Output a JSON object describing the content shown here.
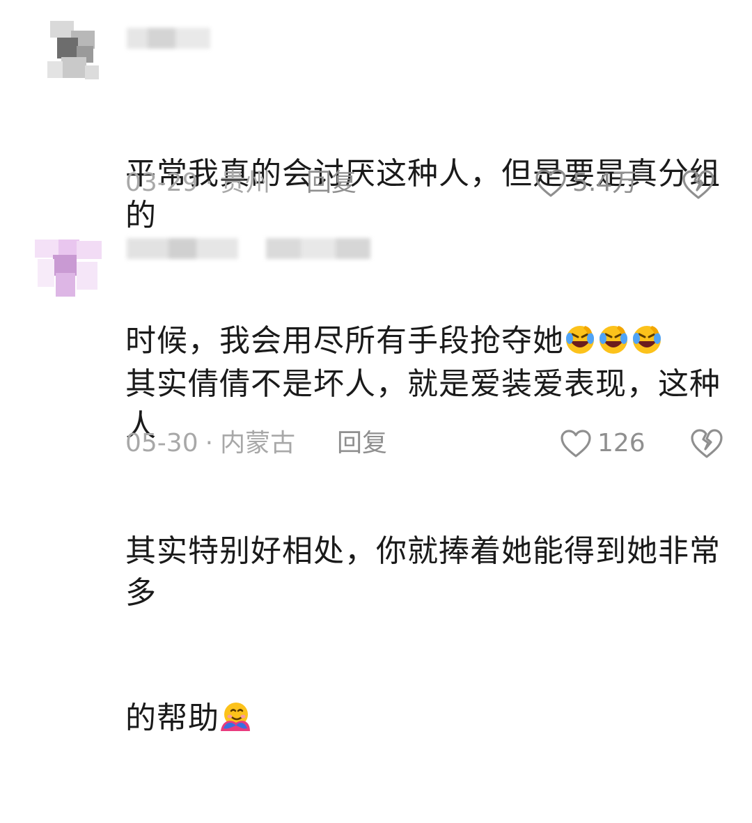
{
  "comments": [
    {
      "text_line1": "平常我真的会讨厌这种人，但是要是真分组的",
      "text_line2": "时候，我会用尽所有手段抢夺她",
      "emoji": "laughing-crying-emoji",
      "date": "03-29",
      "location": "贵州",
      "reply_label": "回复",
      "likes": "5.4万"
    },
    {
      "text_line1": "其实倩倩不是坏人，就是爱装爱表现，这种人",
      "text_line2": "其实特别好相处，你就捧着她能得到她非常多",
      "text_line3": "的帮助",
      "emoji": "hugging-face-emoji",
      "date": "05-30",
      "location": "内蒙古",
      "reply_label": "回复",
      "likes": "126"
    }
  ],
  "separator": "·",
  "colors": {
    "text": "#1a1a1a",
    "meta": "#a8a8a8",
    "icon": "#8f8f8f"
  }
}
